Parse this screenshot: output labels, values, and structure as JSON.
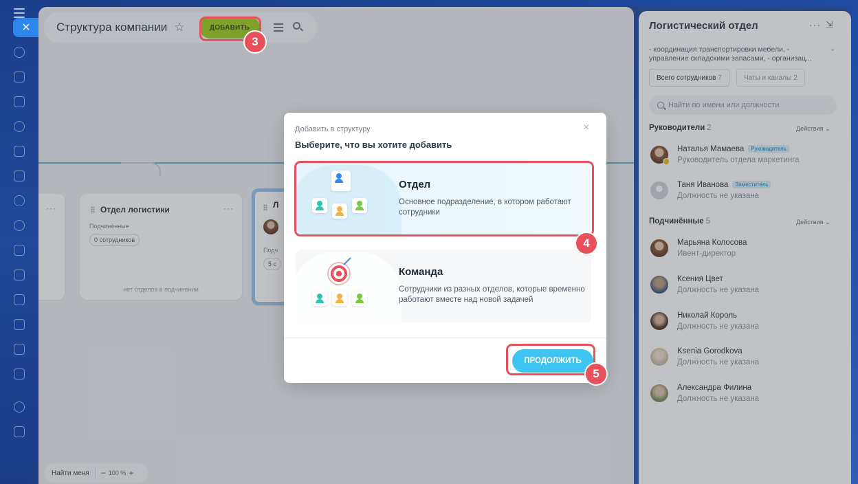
{
  "canvas": {
    "page_title": "Структура компании",
    "add_button": "ДОБАВИТЬ",
    "find_me": "Найти меня",
    "zoom": "100 %",
    "zoom_minus": "−",
    "zoom_plus": "+",
    "departments": [
      {
        "title": "Отдел логистики",
        "sub_label": "Подчинённые",
        "count_badge": "0 сотрудников",
        "empty_text": "нет отделов в подчинении"
      },
      {
        "title": "Л",
        "sub_label": "Подч",
        "count_badge": "5 с"
      }
    ]
  },
  "panel": {
    "title": "Логистический отдел",
    "description": "- координация транспортировки мебели, - управление складскими запасами, - организац...",
    "tabs": [
      {
        "label": "Всего сотрудников",
        "count": "7"
      },
      {
        "label": "Чаты и каналы",
        "count": "2"
      }
    ],
    "search_placeholder": "Найти по имени или должности",
    "heads_section": {
      "label": "Руководители",
      "count": "2",
      "actions": "Действия"
    },
    "heads": [
      {
        "name": "Наталья Мамаева",
        "badge": "Руководитель",
        "role": "Руководитель отдела маркетинга"
      },
      {
        "name": "Таня Иванова",
        "badge": "Заместитель",
        "role": "Должность не указана"
      }
    ],
    "subs_section": {
      "label": "Подчинённые",
      "count": "5",
      "actions": "Действия"
    },
    "subordinates": [
      {
        "name": "Марьяна Колосова",
        "role": "Ивент-директор"
      },
      {
        "name": "Ксения Цвет",
        "role": "Должность не указана"
      },
      {
        "name": "Николай Король",
        "role": "Должность не указана"
      },
      {
        "name": "Ksenia Gorodkova",
        "role": "Должность не указана"
      },
      {
        "name": "Александра Филина",
        "role": "Должность не указана"
      }
    ]
  },
  "modal": {
    "subtitle": "Добавить в структуру",
    "title": "Выберите, что вы хотите добавить",
    "close": "×",
    "options": [
      {
        "name": "Отдел",
        "desc": "Основное подразделение, в котором работают сотрудники"
      },
      {
        "name": "Команда",
        "desc": "Сотрудники из разных отделов, которые временно работают вместе над новой задачей"
      }
    ],
    "continue_button": "ПРОДОЛЖИТЬ"
  },
  "callouts": [
    "3",
    "4",
    "5"
  ],
  "colors": {
    "accent_green": "#9fcf1a",
    "accent_blue": "#3fc3f0",
    "callout_red": "#e8505b"
  }
}
